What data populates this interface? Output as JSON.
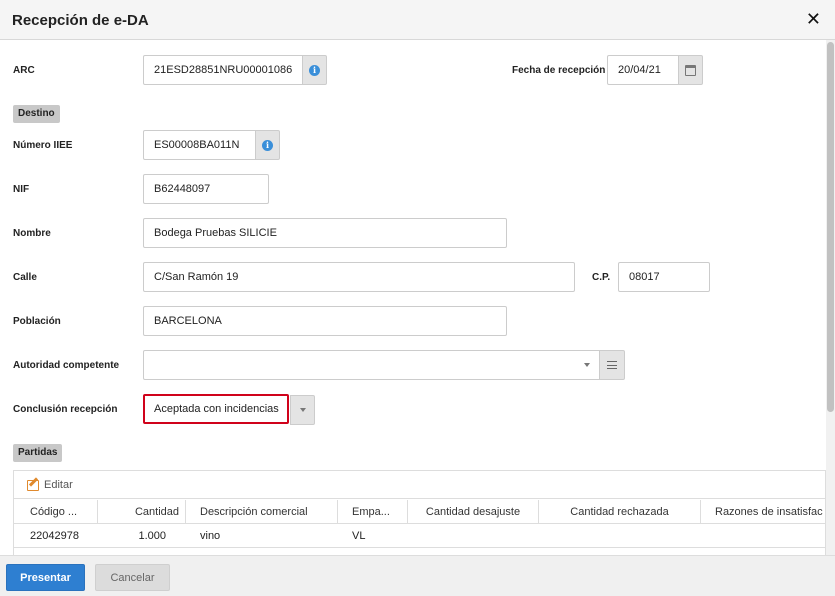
{
  "dialog": {
    "title": "Recepción de e-DA"
  },
  "form": {
    "arc": {
      "label": "ARC",
      "value": "21ESD28851NRU00001086"
    },
    "fecha_recepcion": {
      "label": "Fecha de recepción",
      "value": "20/04/21"
    },
    "destino_section": "Destino",
    "numero_iiee": {
      "label": "Número IIEE",
      "value": "ES00008BA011N"
    },
    "nif": {
      "label": "NIF",
      "value": "B62448097"
    },
    "nombre": {
      "label": "Nombre",
      "value": "Bodega Pruebas SILICIE"
    },
    "calle": {
      "label": "Calle",
      "value": "C/San Ramón 19"
    },
    "cp": {
      "label": "C.P.",
      "value": "08017"
    },
    "poblacion": {
      "label": "Población",
      "value": "BARCELONA"
    },
    "autoridad": {
      "label": "Autoridad competente",
      "value": ""
    },
    "conclusion": {
      "label": "Conclusión recepción",
      "value": "Aceptada con incidencias",
      "highlight_color": "#d0021b"
    }
  },
  "partidas": {
    "section": "Partidas",
    "edit_label": "Editar",
    "columns": [
      "Código ...",
      "Cantidad",
      "Descripción comercial",
      "Empa...",
      "Cantidad desajuste",
      "Cantidad rechazada",
      "Razones de insatisfac"
    ],
    "rows": [
      {
        "codigo": "22042978",
        "cantidad": "1.000",
        "descripcion": "vino",
        "empaque": "VL",
        "desajuste": "",
        "rechazada": "",
        "razones": ""
      }
    ]
  },
  "footer": {
    "primary_label": "Presentar",
    "secondary_label": "Cancelar"
  },
  "colors": {
    "primary": "#2e7fd1",
    "info": "#3a8fd9",
    "edit_icon": "#e08a2e"
  }
}
